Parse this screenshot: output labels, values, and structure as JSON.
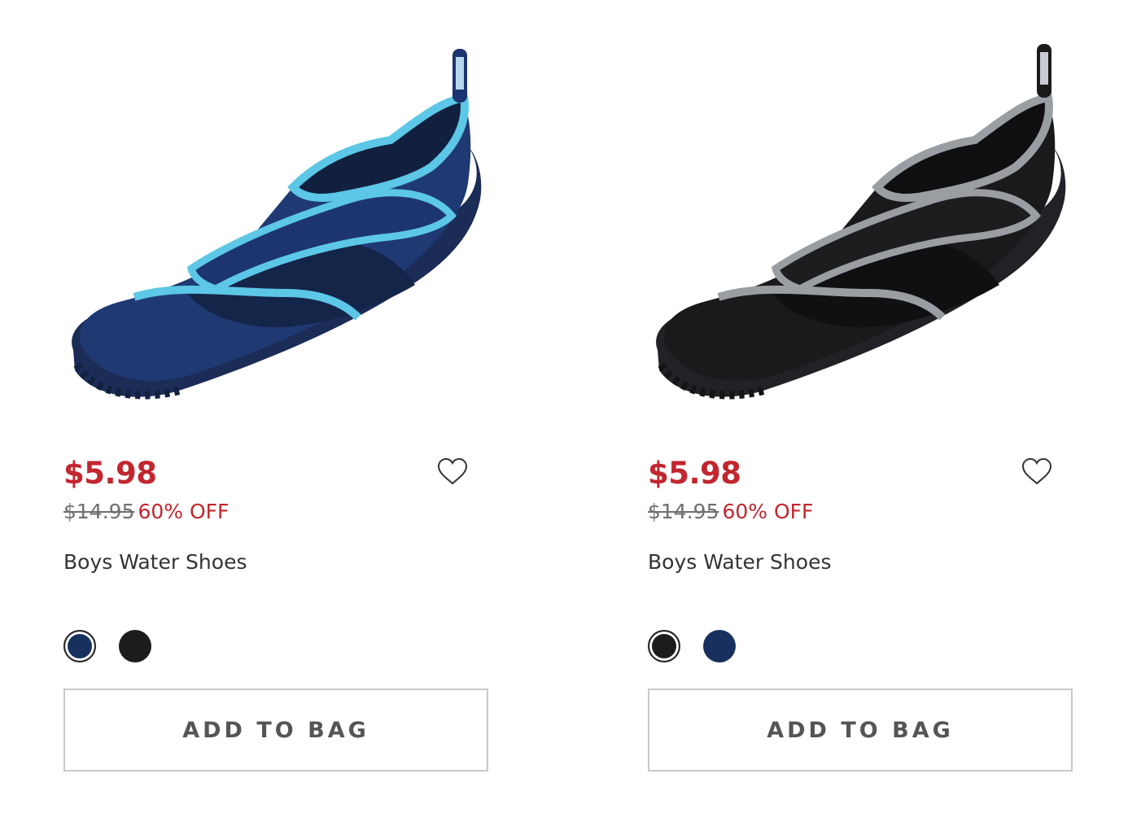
{
  "colors": {
    "sale": "#c2262e",
    "navy": "#17305e",
    "black": "#1c1c1e",
    "button_border": "#c9c9c9"
  },
  "products": [
    {
      "name": "Boys Water Shoes",
      "sale_price": "$5.98",
      "original_price": "$14.95",
      "discount": "60% OFF",
      "image_alt": "Navy water shoe with light blue trim",
      "swatches": [
        "navy",
        "black"
      ],
      "selected_swatch": "navy",
      "add_to_bag_label": "ADD TO BAG",
      "wishlist_icon": "heart-icon"
    },
    {
      "name": "Boys Water Shoes",
      "sale_price": "$5.98",
      "original_price": "$14.95",
      "discount": "60% OFF",
      "image_alt": "Black water shoe with gray trim",
      "swatches": [
        "black",
        "navy"
      ],
      "selected_swatch": "black",
      "add_to_bag_label": "ADD TO BAG",
      "wishlist_icon": "heart-icon"
    }
  ]
}
